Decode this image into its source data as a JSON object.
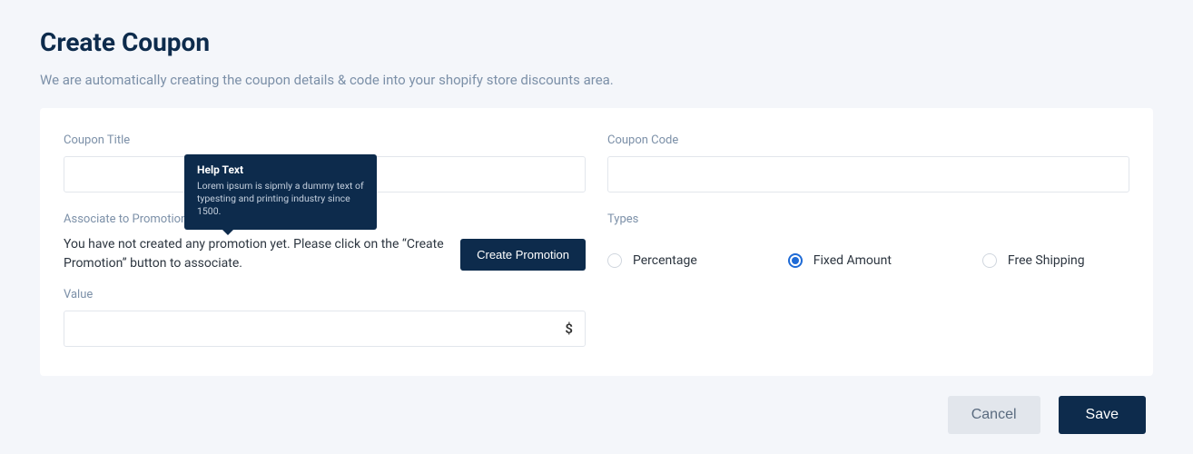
{
  "header": {
    "title": "Create Coupon",
    "subtitle": "We are automatically creating the coupon details & code into your shopify store discounts area."
  },
  "form": {
    "coupon_title": {
      "label": "Coupon Title",
      "value": ""
    },
    "coupon_code": {
      "label": "Coupon Code",
      "value": ""
    },
    "associate": {
      "label": "Associate to Promotion Section",
      "empty_text": "You have not created any promotion yet. Please click on the “Create Promotion” button to associate.",
      "create_button": "Create Promotion"
    },
    "value": {
      "label": "Value",
      "value": "",
      "suffix": "$"
    },
    "types": {
      "label": "Types",
      "options": [
        {
          "label": "Percentage",
          "selected": false
        },
        {
          "label": "Fixed Amount",
          "selected": true
        },
        {
          "label": "Free Shipping",
          "selected": false
        }
      ]
    }
  },
  "tooltip": {
    "title": "Help Text",
    "body": "Lorem ipsum is sipmly a dummy text of typesting and printing industry since 1500."
  },
  "footer": {
    "cancel": "Cancel",
    "save": "Save"
  }
}
